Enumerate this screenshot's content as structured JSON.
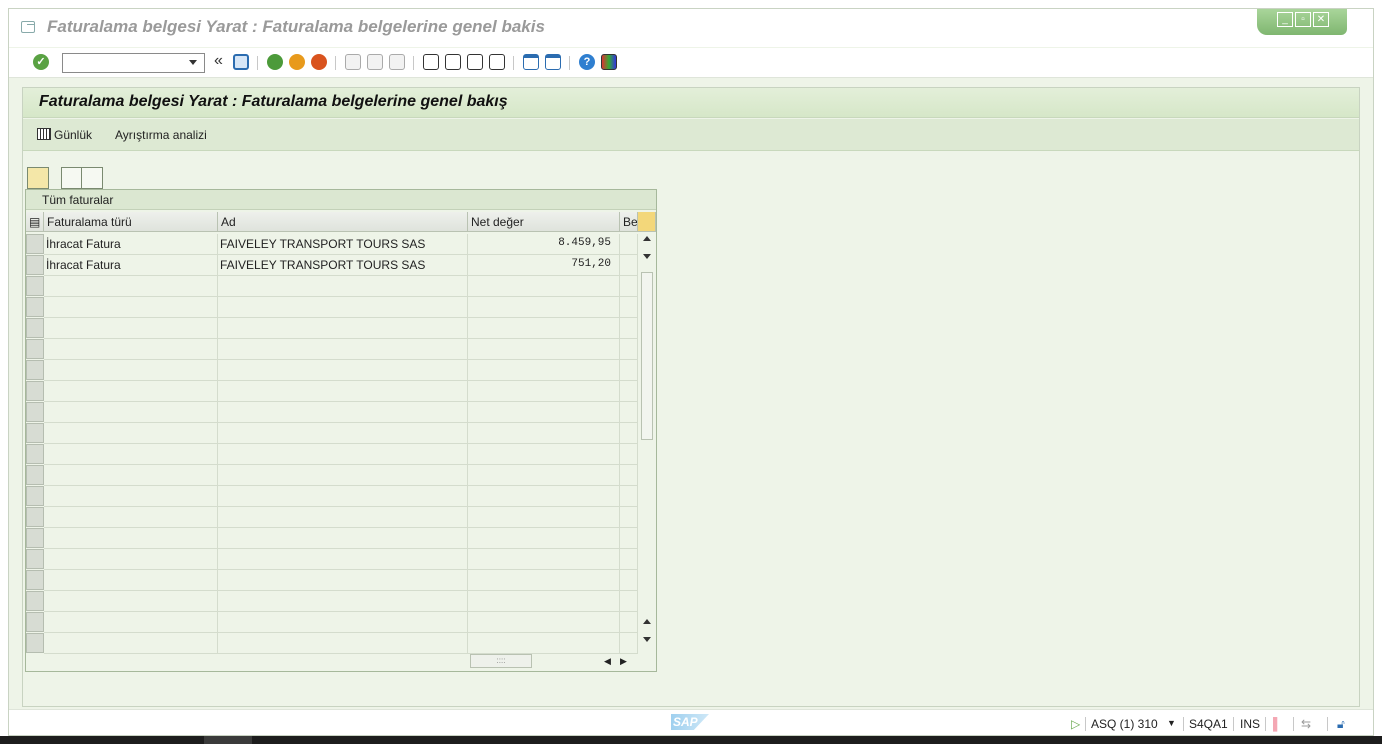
{
  "window": {
    "title": "Faturalama belgesi Yarat : Faturalama belgelerine genel bakis"
  },
  "toolbar": {
    "command_value": "",
    "icons": [
      "enter-icon",
      "back-icon",
      "save-icon",
      "back-green-icon",
      "exit-icon",
      "cancel-icon",
      "print-icon",
      "find-icon",
      "find-next-icon",
      "first-page-icon",
      "previous-page-icon",
      "next-page-icon",
      "last-page-icon",
      "create-session-icon",
      "shortcut-icon",
      "help-icon",
      "customize-layout-icon"
    ]
  },
  "panel": {
    "title": "Faturalama belgesi Yarat : Faturalama belgelerine genel bakış",
    "actions": {
      "log_label": "Günlük",
      "split_label": "Ayrıştırma analizi"
    }
  },
  "alv": {
    "title": "Tüm faturalar",
    "columns": [
      "Faturalama türü",
      "Ad",
      "Net değer",
      "Be"
    ],
    "rows": [
      {
        "type": "İhracat Fatura",
        "name": "FAIVELEY TRANSPORT TOURS SAS",
        "net": "8.459,95"
      },
      {
        "type": "İhracat Fatura",
        "name": "FAIVELEY TRANSPORT TOURS SAS",
        "net": "751,20"
      }
    ]
  },
  "status": {
    "system": "ASQ (1) 310",
    "server": "S4QA1",
    "mode": "INS",
    "logo": "SAP"
  },
  "colors": {
    "accent_green": "#5aa243",
    "panel_bg": "#eef4e8",
    "header_green": "#d6e7c8"
  }
}
